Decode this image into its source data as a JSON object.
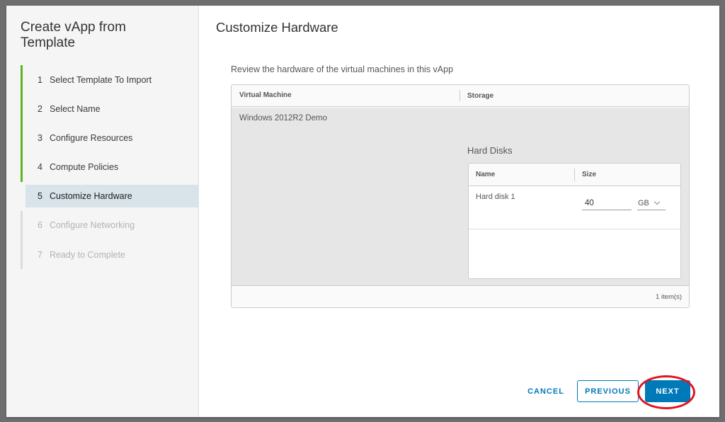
{
  "wizard": {
    "title": "Create vApp from Template",
    "steps": [
      {
        "num": "1",
        "label": "Select Template To Import"
      },
      {
        "num": "2",
        "label": "Select Name"
      },
      {
        "num": "3",
        "label": "Configure Resources"
      },
      {
        "num": "4",
        "label": "Compute Policies"
      },
      {
        "num": "5",
        "label": "Customize Hardware"
      },
      {
        "num": "6",
        "label": "Configure Networking"
      },
      {
        "num": "7",
        "label": "Ready to Complete"
      }
    ],
    "active_step": 5
  },
  "main": {
    "title": "Customize Hardware",
    "description": "Review the hardware of the virtual machines in this vApp",
    "grid": {
      "columns": [
        "Virtual Machine",
        "Storage"
      ],
      "row": {
        "vm_name": "Windows 2012R2 Demo",
        "hard_disks": {
          "title": "Hard Disks",
          "columns": [
            "Name",
            "Size"
          ],
          "rows": [
            {
              "name": "Hard disk 1",
              "size": "40",
              "unit": "GB"
            }
          ]
        }
      },
      "footer": "1 item(s)"
    }
  },
  "buttons": {
    "cancel": "CANCEL",
    "previous": "PREVIOUS",
    "next": "NEXT"
  },
  "colors": {
    "accent": "#0079b8",
    "completed_step": "#5fb322",
    "highlight": "#e3131f"
  }
}
